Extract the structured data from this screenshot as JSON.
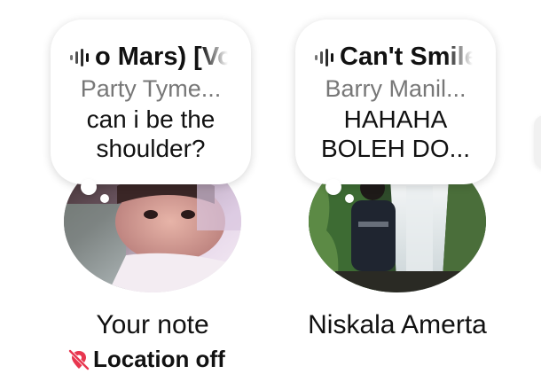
{
  "notes": [
    {
      "song_title": "o Mars) [Vo",
      "artist": "Party Tyme...",
      "note_lines": [
        "can i  be the",
        "shoulder?"
      ],
      "name": "Your note",
      "location_status": "Location off",
      "location_icon": "location-off-icon"
    },
    {
      "song_title": "Can't Smile",
      "artist": "Barry Manil...",
      "note_lines": [
        "HAHAHA",
        "BOLEH DO..."
      ],
      "name": "Niskala Amerta"
    }
  ],
  "colors": {
    "primary_text": "#111111",
    "secondary_text": "#777777",
    "location_off_icon": "#e8364f",
    "bubble_bg": "#ffffff"
  }
}
